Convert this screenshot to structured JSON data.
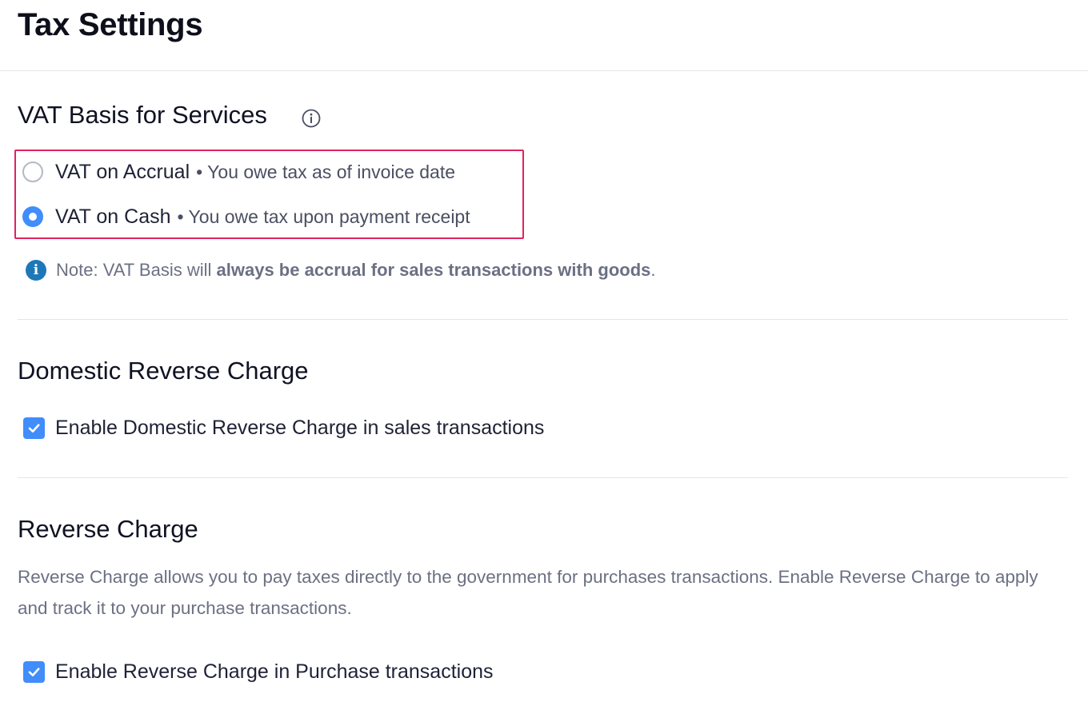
{
  "page": {
    "title": "Tax Settings"
  },
  "vat_basis": {
    "heading": "VAT Basis for Services",
    "info_icon": "info-outline-icon",
    "options": [
      {
        "label": "VAT on Accrual",
        "description": "• You owe tax as of invoice date",
        "selected": false
      },
      {
        "label": "VAT on Cash",
        "description": "• You owe tax upon payment receipt",
        "selected": true
      }
    ],
    "note": {
      "icon": "info-filled-icon",
      "prefix": "Note: VAT Basis will ",
      "emphasis": "always be accrual for sales transactions with goods",
      "suffix": "."
    }
  },
  "domestic_reverse_charge": {
    "heading": "Domestic Reverse Charge",
    "checkbox_label": "Enable Domestic Reverse Charge in sales transactions",
    "checked": true
  },
  "reverse_charge": {
    "heading": "Reverse Charge",
    "description": "Reverse Charge allows you to pay taxes directly to the government for purchases transactions. Enable Reverse Charge to apply and track it to your purchase transactions.",
    "checkbox_label": "Enable Reverse Charge in Purchase transactions",
    "checked": true
  },
  "colors": {
    "accent": "#408dfb",
    "highlight_border": "#e0245e",
    "note_icon": "#1e78b8",
    "muted_text": "#6b7083"
  }
}
